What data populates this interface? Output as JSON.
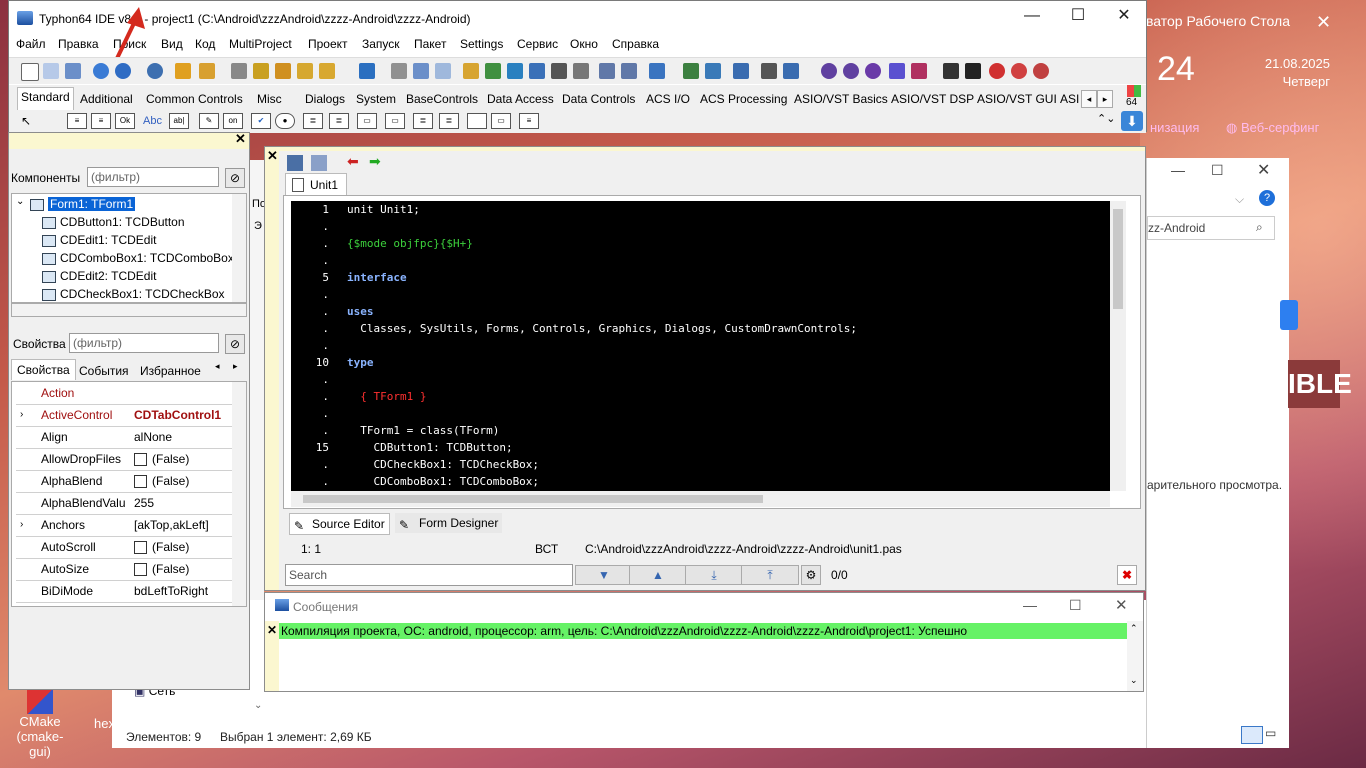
{
  "desktop": {
    "explorer_title": "ватор Рабочего Стола",
    "date": "21.08.2025",
    "weekday": "Четверг",
    "day": "24",
    "links": [
      "низация",
      "Веб-серфинг"
    ],
    "preview_text": "арительного просмотра.",
    "explorer_search": "zz-Android",
    "network_label": "Сеть",
    "status_items": "Элементов: 9",
    "status_selected": "Выбран 1 элемент: 2,69 КБ",
    "icon_cmake": "CMake\n(cmake-gui)",
    "icon_hex": "hex",
    "brand_fragment": "IBLE",
    "left_labels": [
      "По",
      "Э"
    ]
  },
  "ide": {
    "title": "Typhon64 IDE v8.7 - project1 (C:\\Android\\zzzAndroid\\zzzz-Android\\zzzz-Android)",
    "menu": [
      "Файл",
      "Правка",
      "Поиск",
      "Вид",
      "Код",
      "MultiProject",
      "Проект",
      "Запуск",
      "Пакет",
      "Settings",
      "Сервис",
      "Окно",
      "Справка"
    ],
    "palette_tabs": [
      "Standard",
      "Additional",
      "Common Controls",
      "Misc",
      "Dialogs",
      "System",
      "BaseControls",
      "Data Access",
      "Data Controls",
      "ACS I/O",
      "ACS Processing",
      "ASIO/VST Basics",
      "ASIO/VST DSP",
      "ASIO/VST GUI",
      "ASI"
    ],
    "badge_64": "64"
  },
  "inspector": {
    "components_label": "Компоненты",
    "filter_placeholder": "(фильтр)",
    "tree": [
      "Form1: TForm1",
      "CDButton1: TCDButton",
      "CDEdit1: TCDEdit",
      "CDComboBox1: TCDComboBox",
      "CDEdit2: TCDEdit",
      "CDCheckBox1: TCDCheckBox"
    ],
    "properties_label": "Свойства",
    "tabs": [
      "Свойства",
      "События",
      "Избранное"
    ],
    "props": [
      {
        "name": "Action",
        "value": "",
        "checkbox": false
      },
      {
        "name": "ActiveControl",
        "value": "CDTabControl1",
        "checkbox": false
      },
      {
        "name": "Align",
        "value": "alNone",
        "checkbox": false
      },
      {
        "name": "AllowDropFiles",
        "value": "(False)",
        "checkbox": true
      },
      {
        "name": "AlphaBlend",
        "value": "(False)",
        "checkbox": true
      },
      {
        "name": "AlphaBlendValu",
        "value": "255",
        "checkbox": false
      },
      {
        "name": "Anchors",
        "value": "[akTop,akLeft]",
        "checkbox": false
      },
      {
        "name": "AutoScroll",
        "value": "(False)",
        "checkbox": true
      },
      {
        "name": "AutoSize",
        "value": "(False)",
        "checkbox": true
      },
      {
        "name": "BiDiMode",
        "value": "bdLeftToRight",
        "checkbox": false
      }
    ]
  },
  "editor": {
    "tab": "Unit1",
    "lines": [
      {
        "n": "1",
        "text": "unit Unit1;",
        "color": "#ffffff"
      },
      {
        "n": ".",
        "text": "",
        "color": "#ffffff"
      },
      {
        "n": ".",
        "text": "{$mode objfpc}{$H+}",
        "color": "#3cd03c"
      },
      {
        "n": ".",
        "text": "",
        "color": "#ffffff"
      },
      {
        "n": "5",
        "text": "interface",
        "color": "#8ab4ff"
      },
      {
        "n": ".",
        "text": "",
        "color": "#ffffff"
      },
      {
        "n": ".",
        "text": "uses",
        "color": "#8ab4ff"
      },
      {
        "n": ".",
        "text": "  Classes, SysUtils, Forms, Controls, Graphics, Dialogs, CustomDrawnControls;",
        "color": "#ffffff"
      },
      {
        "n": ".",
        "text": "",
        "color": "#ffffff"
      },
      {
        "n": "10",
        "text": "type",
        "color": "#8ab4ff"
      },
      {
        "n": ".",
        "text": "",
        "color": "#ffffff"
      },
      {
        "n": ".",
        "text": "  { TForm1 }",
        "color": "#ff3030"
      },
      {
        "n": ".",
        "text": "",
        "color": "#ffffff"
      },
      {
        "n": ".",
        "text": "  TForm1 = class(TForm)",
        "color": "#ffffff"
      },
      {
        "n": "15",
        "text": "    CDButton1: TCDButton;",
        "color": "#ffffff"
      },
      {
        "n": ".",
        "text": "    CDCheckBox1: TCDCheckBox;",
        "color": "#ffffff"
      },
      {
        "n": ".",
        "text": "    CDComboBox1: TCDComboBox;",
        "color": "#ffffff"
      }
    ],
    "bottom_tabs": [
      "Source Editor",
      "Form Designer"
    ],
    "status": {
      "pos": "1:  1",
      "mode": "ВСТ",
      "path": "C:\\Android\\zzzAndroid\\zzzz-Android\\zzzz-Android\\unit1.pas"
    },
    "search_placeholder": "Search",
    "search_count": "0/0"
  },
  "messages": {
    "title": "Сообщения",
    "line": "Компиляция проекта, ОС: android, процессор: arm, цель: C:\\Android\\zzzAndroid\\zzzz-Android\\zzzz-Android\\project1: Успешно",
    "line_bg": "#66f266"
  }
}
